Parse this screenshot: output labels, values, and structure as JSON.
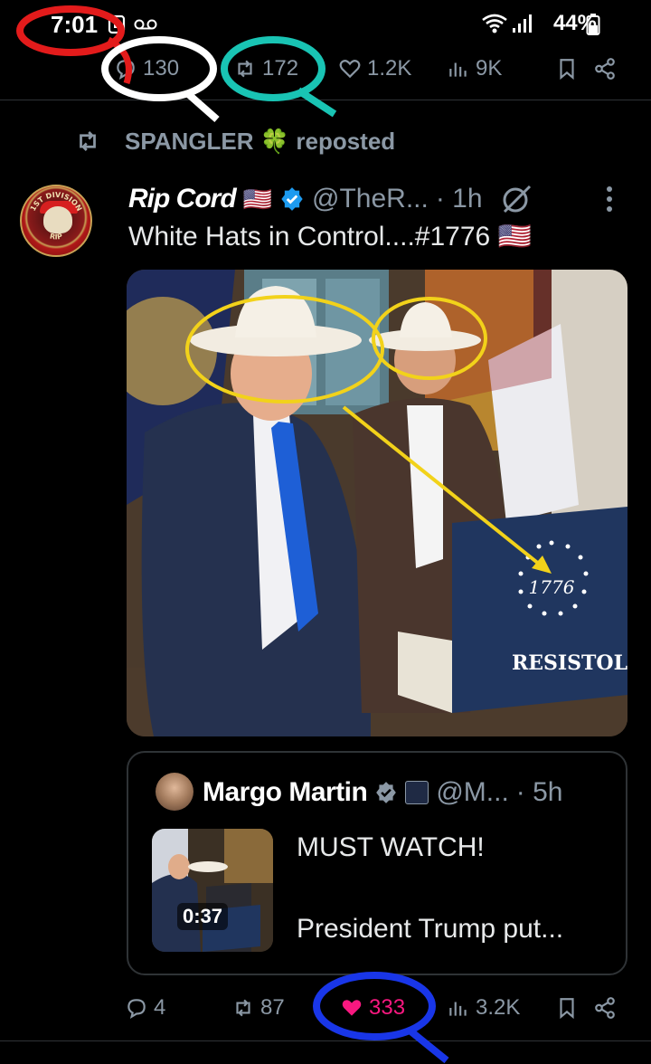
{
  "status_bar": {
    "time": "7:01",
    "battery": "44%",
    "icons": [
      "sim-icon",
      "voicemail-icon",
      "wifi-icon",
      "signal-icon",
      "battery-icon"
    ]
  },
  "prev_post_actions": {
    "replies": "130",
    "reposts": "172",
    "likes": "1.2K",
    "views": "9K"
  },
  "repost_context": {
    "reposter": "SPANGLER",
    "emoji": "🍀",
    "label": "reposted"
  },
  "post": {
    "display_name": "Rip Cord",
    "flag": "🇺🇸",
    "handle": "@TheR...",
    "time": "· 1h",
    "text": "White Hats in Control....#1776 🇺🇸",
    "media": {
      "box_year": "1776",
      "box_brand": "RESISTOL"
    },
    "avatar": {
      "top_text": "1ST DIVISION",
      "bottom_text": "RIP"
    }
  },
  "quoted_post": {
    "display_name": "Margo Martin",
    "handle": "@M...",
    "time": "· 5h",
    "duration": "0:37",
    "text_line1": "MUST WATCH!",
    "text_line2": "President Trump put..."
  },
  "post_actions": {
    "replies": "4",
    "reposts": "87",
    "likes": "333",
    "views": "3.2K"
  },
  "colors": {
    "background": "#000000",
    "text": "#e7e9ea",
    "secondary": "#8b98a5",
    "like_active": "#f91880",
    "verified": "#1d9bf0",
    "annotation_red": "#e31b1b",
    "annotation_white": "#ffffff",
    "annotation_teal": "#19c4b4",
    "annotation_blue": "#1936e8",
    "annotation_yellow": "#f2d21a"
  }
}
